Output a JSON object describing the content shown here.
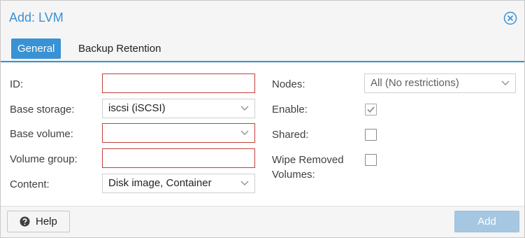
{
  "dialog": {
    "title": "Add: LVM"
  },
  "tabs": [
    {
      "label": "General",
      "active": true
    },
    {
      "label": "Backup Retention",
      "active": false
    }
  ],
  "form": {
    "left": {
      "id": {
        "label": "ID:",
        "value": ""
      },
      "base_storage": {
        "label": "Base storage:",
        "value": "iscsi (iSCSI)"
      },
      "base_volume": {
        "label": "Base volume:",
        "value": ""
      },
      "volume_group": {
        "label": "Volume group:",
        "value": ""
      },
      "content": {
        "label": "Content:",
        "value": "Disk image, Container"
      }
    },
    "right": {
      "nodes": {
        "label": "Nodes:",
        "value": "All (No restrictions)"
      },
      "enable": {
        "label": "Enable:",
        "checked": true
      },
      "shared": {
        "label": "Shared:",
        "checked": false
      },
      "wipe_removed": {
        "label_line1": "Wipe Removed",
        "label_line2": "Volumes:",
        "checked": false
      }
    }
  },
  "footer": {
    "help_label": "Help",
    "add_label": "Add"
  },
  "icons": {
    "close": "close-circle-icon",
    "help": "question-circle-icon",
    "dropdown": "chevron-down-icon",
    "check": "checkmark-icon"
  },
  "colors": {
    "accent": "#3892d4",
    "invalid_border": "#c1403a",
    "disabled_button": "#a5c7e2"
  }
}
